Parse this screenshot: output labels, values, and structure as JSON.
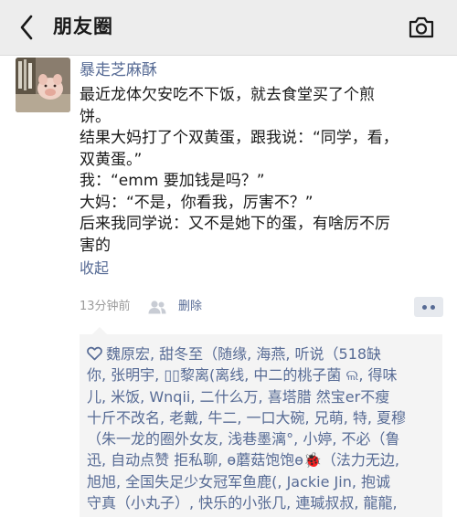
{
  "header": {
    "title": "朋友圈",
    "back_icon": "back-arrow-icon",
    "camera_icon": "camera-icon"
  },
  "post": {
    "author": "暴走芝麻酥",
    "text_lines": [
      "最近龙体欠安吃不下饭，就去食堂买了个煎",
      "饼。",
      "结果大妈打了个双黄蛋，跟我说：“同学，看，",
      "双黄蛋。”",
      "我：“emm 要加钱是吗？”",
      "大妈：“不是，你看我，厉害不？”",
      "后来我同学说：又不是她下的蛋，有啥厉不厉",
      "害的"
    ],
    "collapse_label": "收起",
    "timestamp": "13分钟前",
    "delete_label": "删除"
  },
  "likes": {
    "lines": [
      "魏原宏, 甜冬至（随缘, 海燕, 听说（518缺",
      "你, 张明宇, ▯▯黎离(离线, 中二的桃子菌 ଲ, 得味",
      "儿, 米饭, Wnqii,     二什么万, 喜塔腊 然宝er不瘦",
      "十斤不改名, 老戴, 牛二, 一口大碗, 兄萌, 特, 夏穆",
      "（朱一龙的圈外女友, 浅巷墨漓°, 小婷, 不必（鲁",
      "迅, 自动点赞 拒私聊, ɵ蘑菇饱饱ɵ🐞（法力无边,",
      "旭旭, 全国失足少女冠军鱼鹿(, Jackie Jin, 抱诚",
      "守真（小丸子）, 快乐的小张几, 連瑊叔叔, 龍龍,"
    ]
  },
  "colors": {
    "link": "#576b95",
    "header_bg": "#ededed",
    "likes_bg": "#f4f4f4",
    "timestamp": "#9b9b9b"
  }
}
